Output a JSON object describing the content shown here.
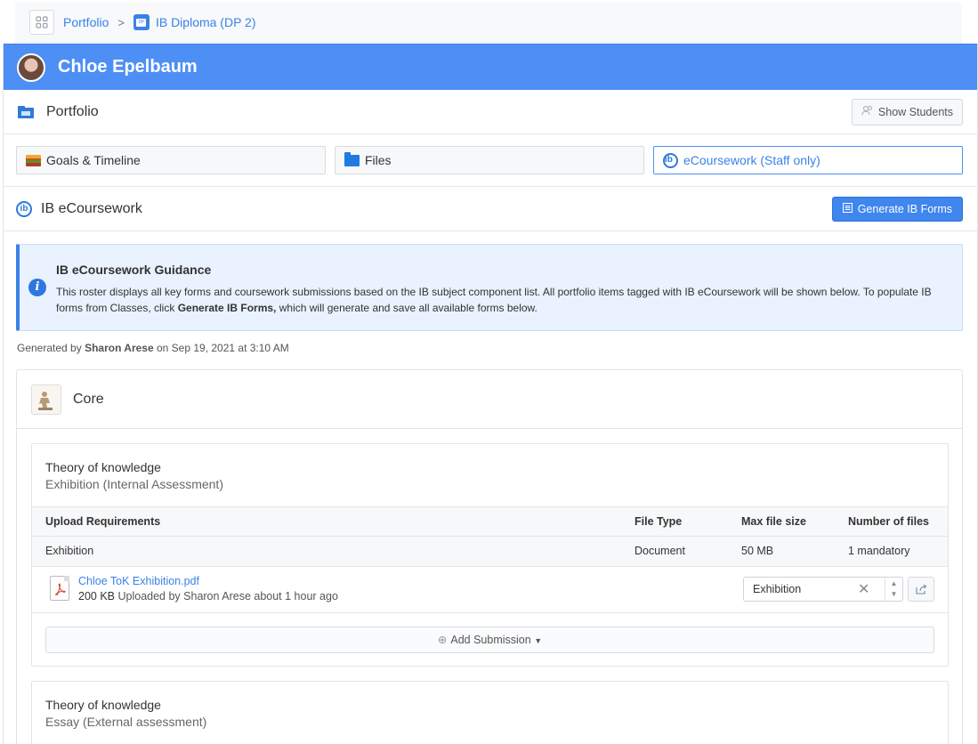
{
  "breadcrumb": {
    "portfolio_label": "Portfolio",
    "separator": ">",
    "dp_label": "IB Diploma (DP 2)"
  },
  "student": {
    "name": "Chloe Epelbaum"
  },
  "portfolio_header": {
    "title": "Portfolio",
    "show_students_label": "Show Students"
  },
  "tabs": [
    {
      "label": "Goals & Timeline"
    },
    {
      "label": "Files"
    },
    {
      "label": "eCoursework (Staff only)"
    }
  ],
  "ecoursework": {
    "title": "IB eCoursework",
    "generate_label": "Generate IB Forms"
  },
  "guidance": {
    "title": "IB eCoursework Guidance",
    "body_part1": "This roster displays all key forms and coursework submissions based on the IB subject component list. All portfolio items tagged with IB eCoursework will be shown below. To populate IB forms from Classes, click ",
    "body_bold": "Generate IB Forms,",
    "body_part2": " which will generate and save all available forms below."
  },
  "generated": {
    "prefix": "Generated by ",
    "author": "Sharon Arese",
    "suffix": " on Sep 19, 2021 at 3:10 AM"
  },
  "core": {
    "title": "Core",
    "components": [
      {
        "subject": "Theory of knowledge",
        "type": "Exhibition (Internal Assessment)",
        "table_headers": [
          "Upload Requirements",
          "File Type",
          "Max file size",
          "Number of files"
        ],
        "requirements": [
          {
            "name": "Exhibition",
            "file_type": "Document",
            "max_size": "50 MB",
            "count": "1 mandatory"
          }
        ],
        "file": {
          "name": "Chloe ToK Exhibition.pdf",
          "size": "200 KB",
          "meta": " Uploaded by Sharon Arese about 1 hour ago",
          "tag": "Exhibition"
        },
        "add_submission_label": "Add Submission"
      },
      {
        "subject": "Theory of knowledge",
        "type": "Essay (External assessment)"
      }
    ]
  }
}
